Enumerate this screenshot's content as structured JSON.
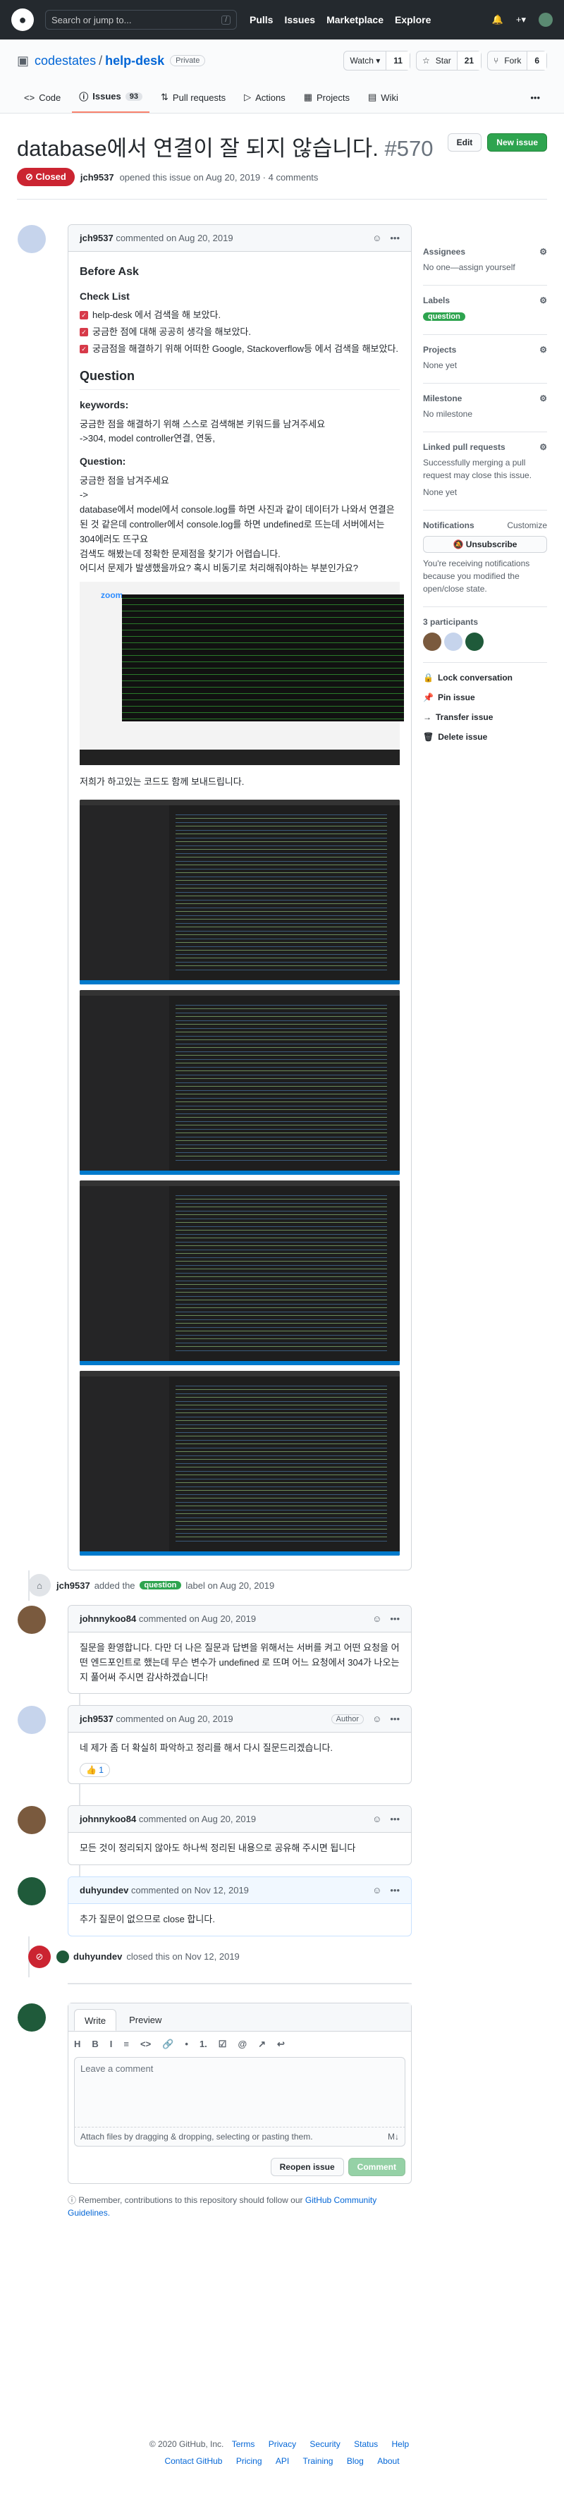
{
  "header": {
    "search_placeholder": "Search or jump to...",
    "search_key": "/",
    "nav": [
      "Pulls",
      "Issues",
      "Marketplace",
      "Explore"
    ],
    "plus": "+▾"
  },
  "repo": {
    "owner": "codestates",
    "sep": "/",
    "name": "help-desk",
    "visibility": "Private",
    "watch": "Watch ▾",
    "watch_count": "11",
    "star": "Star",
    "star_count": "21",
    "fork": "Fork",
    "fork_count": "6"
  },
  "tabs": {
    "code": "Code",
    "issues": "Issues",
    "issues_count": "93",
    "pulls": "Pull requests",
    "actions": "Actions",
    "projects": "Projects",
    "wiki": "Wiki"
  },
  "issue": {
    "title": "database에서 연결이 잘 되지 않습니다.",
    "number": "#570",
    "edit": "Edit",
    "new_issue": "New issue",
    "status": "Closed",
    "meta_author": "jch9537",
    "meta_text": "opened this issue on Aug 20, 2019 · 4 comments"
  },
  "first": {
    "author": "jch9537",
    "action": "commented on Aug 20, 2019",
    "before_ask": "Before Ask",
    "check_list": "Check List",
    "checks": [
      "help-desk 에서 검색을 해 보았다.",
      "궁금한 점에 대해 공공히 생각을 해보았다.",
      "궁금점을 해결하기 위해 어떠한 Google, Stackoverflow등 에서 검색을 해보았다."
    ],
    "question": "Question",
    "keywords_h": "keywords:",
    "keywords_1": "궁금한 점을 해결하기 위해 스스로 검색해본 키워드를 남겨주세요",
    "keywords_2": "->304, model controller연결, 연동,",
    "question_h": "Question:",
    "q1": "궁금한 점을 남겨주세요",
    "q2": "->",
    "q3": "database에서 model에서 console.log를 하면 사진과 같이 데이터가 나와서 연결은 된 것 같은데 controller에서 console.log를 하면 undefined로 뜨는데 서버에서는 304에러도 뜨구요",
    "q4": "검색도 해봤는데 정확한 문제점을 찾기가 어렵습니다.",
    "q5": "어디서 문제가 발생했을까요? 혹시 비동기로 처리해줘야하는 부분인가요?",
    "zoom": "zoom",
    "code_note": "저희가 하고있는 코드도 함께 보내드립니다."
  },
  "label_event": {
    "author": "jch9537",
    "pre": "added the",
    "label": "question",
    "post": "label on Aug 20, 2019"
  },
  "c2": {
    "author": "johnnykoo84",
    "action": "commented on Aug 20, 2019",
    "body": "질문을 환영합니다. 다만 더 나은 질문과 답변을 위해서는 서버를 켜고 어떤 요청을 어떤 엔드포인트로 했는데 무슨 변수가 undefined 로 뜨며 어느 요청에서 304가 나오는지 풀어써 주시면 감사하겠습니다!"
  },
  "c3": {
    "author": "jch9537",
    "action": "commented on Aug 20, 2019",
    "badge": "Author",
    "body": "네 제가 좀 더 확실히 파악하고 정리를 해서 다시 질문드리겠습니다.",
    "reaction": "👍 1"
  },
  "c4": {
    "author": "johnnykoo84",
    "action": "commented on Aug 20, 2019",
    "body": "모든 것이 정리되지 않아도 하나씩 정리된 내용으로 공유해 주시면 됩니다"
  },
  "c5": {
    "author": "duhyundev",
    "action": "commented on Nov 12, 2019",
    "body": "추가 질문이 없으므로 close 합니다."
  },
  "close_event": {
    "author": "duhyundev",
    "text": "closed this on Nov 12, 2019"
  },
  "editor": {
    "write": "Write",
    "preview": "Preview",
    "tools": [
      "H",
      "B",
      "I",
      "≡",
      "<>",
      "🔗",
      "•",
      "1.",
      "☑",
      "@",
      "↗",
      "↩"
    ],
    "placeholder": "Leave a comment",
    "attach": "Attach files by dragging & dropping, selecting or pasting them.",
    "md": "M↓",
    "reopen": "Reopen issue",
    "comment": "Comment"
  },
  "remember": {
    "text": "Remember, contributions to this repository should follow our",
    "link": "GitHub Community Guidelines."
  },
  "sidebar": {
    "assignees": "Assignees",
    "assignees_v": "No one—assign yourself",
    "labels": "Labels",
    "label": "question",
    "projects": "Projects",
    "projects_v": "None yet",
    "milestone": "Milestone",
    "milestone_v": "No milestone",
    "linked": "Linked pull requests",
    "linked_v": "Successfully merging a pull request may close this issue.",
    "linked_v2": "None yet",
    "notif": "Notifications",
    "customize": "Customize",
    "unsub": "Unsubscribe",
    "notif_v": "You're receiving notifications because you modified the open/close state.",
    "participants": "3 participants",
    "lock": "Lock conversation",
    "pin": "Pin issue",
    "transfer": "Transfer issue",
    "delete": "Delete issue"
  },
  "footer": {
    "copy": "© 2020 GitHub, Inc.",
    "row1": [
      "Terms",
      "Privacy",
      "Security",
      "Status",
      "Help"
    ],
    "row2": [
      "Contact GitHub",
      "Pricing",
      "API",
      "Training",
      "Blog",
      "About"
    ]
  }
}
